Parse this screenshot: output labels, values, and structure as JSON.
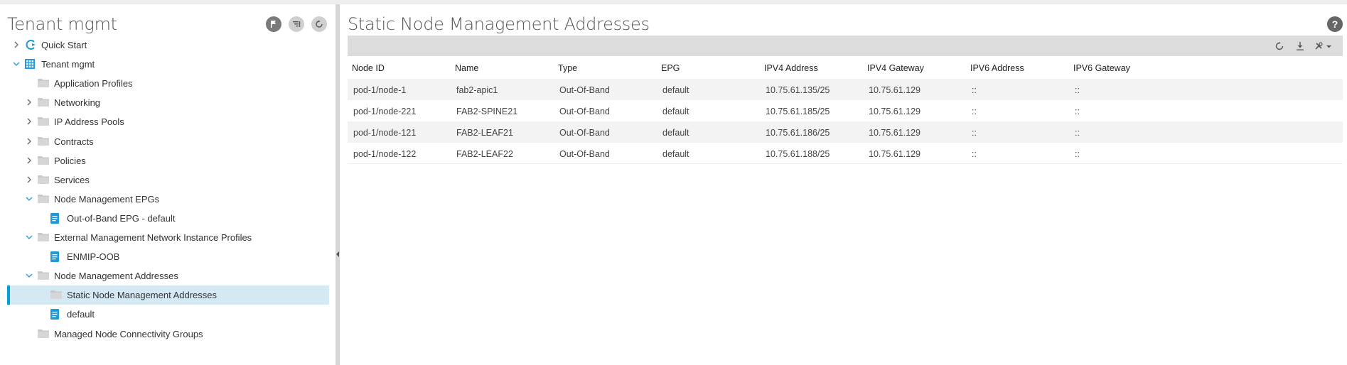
{
  "left_panel": {
    "title": "Tenant mgmt",
    "header_icons": [
      "flag-icon",
      "collapse-list-icon",
      "refresh-icon"
    ],
    "tree": [
      {
        "label": "Quick Start",
        "icon": "quickstart-icon",
        "expander": "right"
      },
      {
        "label": "Tenant mgmt",
        "icon": "tenant-icon",
        "expander": "down"
      },
      {
        "label": "Application Profiles",
        "icon": "folder-icon",
        "expander": "none"
      },
      {
        "label": "Networking",
        "icon": "folder-icon",
        "expander": "right"
      },
      {
        "label": "IP Address Pools",
        "icon": "folder-icon",
        "expander": "right"
      },
      {
        "label": "Contracts",
        "icon": "folder-icon",
        "expander": "right"
      },
      {
        "label": "Policies",
        "icon": "folder-icon",
        "expander": "right"
      },
      {
        "label": "Services",
        "icon": "folder-icon",
        "expander": "right"
      },
      {
        "label": "Node Management EPGs",
        "icon": "folder-icon",
        "expander": "down"
      },
      {
        "label": "Out-of-Band EPG - default",
        "icon": "document-icon",
        "expander": "none"
      },
      {
        "label": "External Management Network Instance Profiles",
        "icon": "folder-icon",
        "expander": "down"
      },
      {
        "label": "ENMIP-OOB",
        "icon": "document-icon",
        "expander": "none"
      },
      {
        "label": "Node Management Addresses",
        "icon": "folder-icon",
        "expander": "down"
      },
      {
        "label": "Static Node Management Addresses",
        "icon": "folder-icon",
        "expander": "none",
        "selected": true
      },
      {
        "label": "default",
        "icon": "document-icon",
        "expander": "none"
      },
      {
        "label": "Managed Node Connectivity Groups",
        "icon": "folder-icon",
        "expander": "none"
      }
    ]
  },
  "main": {
    "title": "Static Node Management Addresses",
    "help_label": "?",
    "toolbar_icons": [
      "refresh-icon",
      "download-icon",
      "tools-dropdown-icon"
    ],
    "columns": [
      "Node ID",
      "Name",
      "Type",
      "EPG",
      "IPV4 Address",
      "IPV4 Gateway",
      "IPV6 Address",
      "IPV6 Gateway"
    ],
    "rows": [
      [
        "pod-1/node-1",
        "fab2-apic1",
        "Out-Of-Band",
        "default",
        "10.75.61.135/25",
        "10.75.61.129",
        "::",
        "::"
      ],
      [
        "pod-1/node-221",
        "FAB2-SPINE21",
        "Out-Of-Band",
        "default",
        "10.75.61.185/25",
        "10.75.61.129",
        "::",
        "::"
      ],
      [
        "pod-1/node-121",
        "FAB2-LEAF21",
        "Out-Of-Band",
        "default",
        "10.75.61.186/25",
        "10.75.61.129",
        "::",
        "::"
      ],
      [
        "pod-1/node-122",
        "FAB2-LEAF22",
        "Out-Of-Band",
        "default",
        "10.75.61.188/25",
        "10.75.61.129",
        "::",
        "::"
      ]
    ]
  },
  "colors": {
    "accent": "#049fd9",
    "selected_row": "#d4e9f4",
    "toolbar": "#dcdcdc"
  }
}
